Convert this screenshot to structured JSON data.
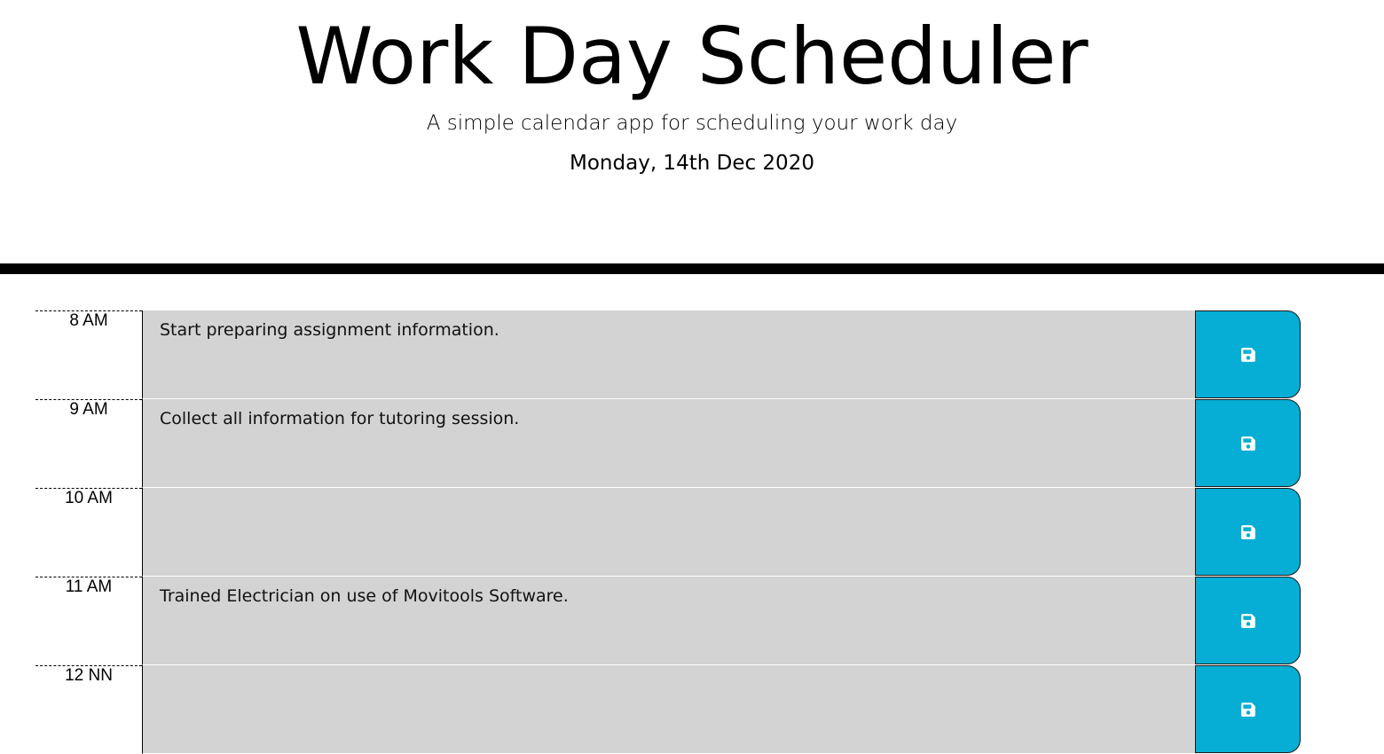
{
  "header": {
    "title": "Work Day Scheduler",
    "subtitle": "A simple calendar app for scheduling your work day",
    "current_day": "Monday, 14th Dec 2020"
  },
  "colors": {
    "past_block": "#d3d3d3",
    "save_button": "#06aed5"
  },
  "time_blocks": [
    {
      "hour": "8 AM",
      "description": "Start preparing assignment information.",
      "save_icon": "save-icon"
    },
    {
      "hour": "9 AM",
      "description": "Collect all information for tutoring session.",
      "save_icon": "save-icon"
    },
    {
      "hour": "10 AM",
      "description": "",
      "save_icon": "save-icon"
    },
    {
      "hour": "11 AM",
      "description": "Trained Electrician on use of Movitools Software.",
      "save_icon": "save-icon"
    },
    {
      "hour": "12 NN",
      "description": "",
      "save_icon": "save-icon"
    }
  ]
}
